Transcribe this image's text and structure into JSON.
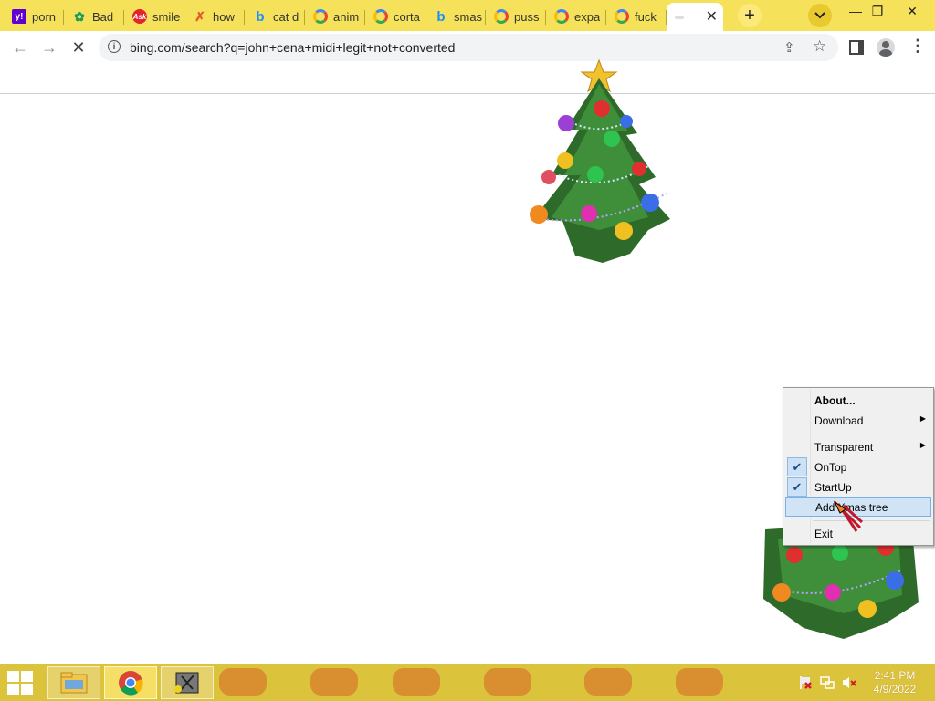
{
  "browser": {
    "tabs": [
      {
        "title": "porn",
        "icon": "yahoo-icon",
        "glyph": "y!"
      },
      {
        "title": "Bad",
        "icon": "bad-site-icon",
        "glyph": "✿"
      },
      {
        "title": "smile",
        "icon": "ask-icon",
        "glyph": "Ask"
      },
      {
        "title": "how",
        "icon": "how-site-icon",
        "glyph": "✗"
      },
      {
        "title": "cat d",
        "icon": "bing-icon",
        "glyph": "b"
      },
      {
        "title": "anim",
        "icon": "google-icon",
        "glyph": ""
      },
      {
        "title": "corta",
        "icon": "google-icon",
        "glyph": ""
      },
      {
        "title": "smas",
        "icon": "bing-icon",
        "glyph": "b"
      },
      {
        "title": "puss",
        "icon": "google-icon",
        "glyph": ""
      },
      {
        "title": "expa",
        "icon": "google-icon",
        "glyph": ""
      },
      {
        "title": "fuck",
        "icon": "google-icon",
        "glyph": ""
      }
    ],
    "active_tab_close": "✕",
    "new_tab": "+",
    "tab_search": "⌄",
    "window_controls": {
      "minimize": "—",
      "restore": "❐",
      "close": "✕"
    },
    "nav": {
      "back": "←",
      "forward": "→",
      "stop": "✕"
    },
    "url": "bing.com/search?q=john+cena+midi+legit+not+converted",
    "info_glyph": "i",
    "share_glyph": "⇪",
    "star_glyph": "☆",
    "menu_glyph": "⋮"
  },
  "context_menu": {
    "items": [
      {
        "label": "About...",
        "bold": true
      },
      {
        "label": "Download",
        "submenu": true
      },
      {
        "label": "Transparent",
        "submenu": true
      },
      {
        "label": "OnTop",
        "checked": true
      },
      {
        "label": "StartUp",
        "checked": true
      },
      {
        "label": "Add Xmas tree",
        "highlighted": true
      },
      {
        "label": "Exit"
      }
    ],
    "submenu_arrow": "▶",
    "check_glyph": "✔"
  },
  "taskbar": {
    "clock_time": "2:41 PM",
    "clock_date": "4/9/2022",
    "apps": [
      "file-explorer",
      "chrome",
      "xmas-tree-app"
    ]
  },
  "colors": {
    "tabstrip": "#f5e25a",
    "taskbar": "#dcc33c",
    "menu_highlight": "#d1e4f6"
  }
}
